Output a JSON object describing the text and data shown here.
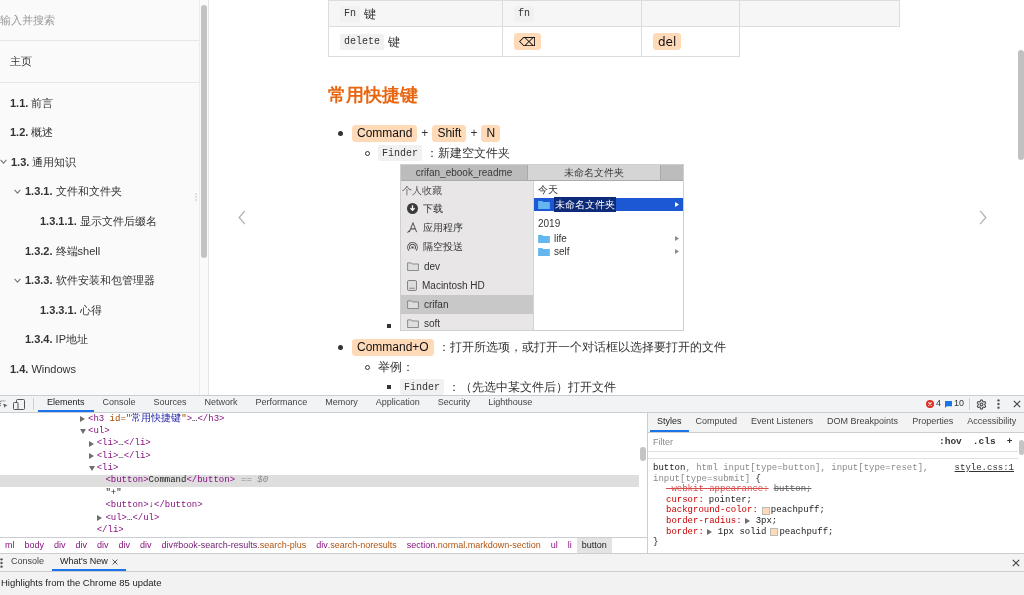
{
  "sidebar": {
    "search": {
      "placeholder": "输入并搜索"
    },
    "home": "主页",
    "items": [
      {
        "number": "1.1.",
        "title": "前言"
      },
      {
        "number": "1.2.",
        "title": "概述"
      },
      {
        "number": "1.3.",
        "title": "通用知识",
        "expanded": true,
        "children": [
          {
            "number": "1.3.1.",
            "title": "文件和文件夹",
            "expanded": true,
            "children": [
              {
                "number": "1.3.1.1.",
                "title": "显示文件后缀名"
              }
            ]
          },
          {
            "number": "1.3.2.",
            "title": "终端shell"
          },
          {
            "number": "1.3.3.",
            "title": "软件安装和包管理器",
            "expanded": true,
            "children": [
              {
                "number": "1.3.3.1.",
                "title": "心得"
              }
            ]
          },
          {
            "number": "1.3.4.",
            "title": "IP地址"
          }
        ]
      },
      {
        "number": "1.4.",
        "title": "Windows"
      }
    ]
  },
  "page": {
    "table": {
      "rows": [
        {
          "cells": [
            {
              "kind": "code_label",
              "code": "Fn",
              "text": "键"
            },
            {
              "kind": "code",
              "code": "fn"
            },
            {
              "kind": "empty"
            },
            {
              "kind": "empty"
            }
          ]
        },
        {
          "cells": [
            {
              "kind": "code_label",
              "code": "delete",
              "text": "键"
            },
            {
              "kind": "key",
              "text": "⌫"
            },
            {
              "kind": "key",
              "text": "del"
            }
          ]
        }
      ]
    },
    "heading": "常用快捷键",
    "list": [
      {
        "parts": [
          {
            "kind": "key",
            "text": "Command"
          },
          {
            "kind": "text",
            "text": "+"
          },
          {
            "kind": "key",
            "text": "Shift"
          },
          {
            "kind": "text",
            "text": "+"
          },
          {
            "kind": "key",
            "text": "N"
          }
        ],
        "children": [
          {
            "parts": [
              {
                "kind": "code",
                "text": "Finder"
              },
              {
                "kind": "text",
                "text": "：新建空文件夹"
              }
            ],
            "children": [
              {
                "parts": [
                  {
                    "kind": "finder_window",
                    "tabs": [
                      {
                        "label": "crifan_ebook_readme",
                        "selected": false
                      },
                      {
                        "label": "未命名文件夹",
                        "selected": true
                      }
                    ],
                    "sidebar": {
                      "heading": "个人收藏",
                      "items": [
                        {
                          "kind": "download",
                          "label": "下载",
                          "selected": false
                        },
                        {
                          "kind": "applications",
                          "label": "应用程序",
                          "selected": false
                        },
                        {
                          "kind": "airdrop",
                          "label": "隔空投送",
                          "selected": false
                        },
                        {
                          "kind": "folder",
                          "label": "dev",
                          "selected": false
                        },
                        {
                          "kind": "disk",
                          "label": "Macintosh HD",
                          "selected": false
                        },
                        {
                          "kind": "folder",
                          "label": "crifan",
                          "selected": true
                        },
                        {
                          "kind": "folder",
                          "label": "soft",
                          "selected": false
                        }
                      ]
                    },
                    "groups": [
                      {
                        "heading": "今天",
                        "items": [
                          {
                            "label": "未命名文件夹",
                            "selected": true
                          }
                        ]
                      },
                      {
                        "heading": "2019",
                        "items": [
                          {
                            "label": "life",
                            "selected": false
                          },
                          {
                            "label": "self",
                            "selected": false
                          }
                        ]
                      }
                    ]
                  }
                ]
              }
            ]
          }
        ]
      },
      {
        "parts": [
          {
            "kind": "key",
            "text": "Command+O"
          },
          {
            "kind": "text",
            "text": "：打开所选项，或打开一个对话框以选择要打开的文件"
          }
        ],
        "children": [
          {
            "parts": [
              {
                "kind": "text",
                "text": "举例："
              }
            ],
            "children": [
              {
                "parts": [
                  {
                    "kind": "code",
                    "text": "Finder"
                  },
                  {
                    "kind": "text",
                    "text": "：（先选中某文件后）打开文件"
                  }
                ]
              }
            ]
          }
        ]
      }
    ]
  },
  "devtools": {
    "toolbar": {
      "tabs": [
        {
          "label": "Elements",
          "selected": true
        },
        {
          "label": "Console",
          "selected": false
        },
        {
          "label": "Sources",
          "selected": false
        },
        {
          "label": "Network",
          "selected": false
        },
        {
          "label": "Performance",
          "selected": false
        },
        {
          "label": "Memory",
          "selected": false
        },
        {
          "label": "Application",
          "selected": false
        },
        {
          "label": "Security",
          "selected": false
        },
        {
          "label": "Lighthouse",
          "selected": false
        }
      ],
      "error_count": "4",
      "message_count": "10"
    },
    "dom_tree": [
      {
        "expanded": false,
        "selected": false,
        "tokens": [
          {
            "kind": "tag",
            "text": "<h3"
          },
          {
            "kind": "attr",
            "text": " id=\""
          },
          {
            "kind": "value",
            "text": "常用快捷键"
          },
          {
            "kind": "attr",
            "text": "\""
          },
          {
            "kind": "tag",
            "text": ">"
          },
          {
            "kind": "text",
            "text": "…"
          },
          {
            "kind": "tag",
            "text": "</h3>"
          }
        ]
      },
      {
        "expanded": true,
        "selected": false,
        "tokens": [
          {
            "kind": "tag",
            "text": "<ul>"
          }
        ],
        "children": [
          {
            "expanded": false,
            "selected": false,
            "tokens": [
              {
                "kind": "tag",
                "text": "<li>"
              },
              {
                "kind": "text",
                "text": "…"
              },
              {
                "kind": "tag",
                "text": "</li>"
              }
            ]
          },
          {
            "expanded": false,
            "selected": false,
            "tokens": [
              {
                "kind": "tag",
                "text": "<li>"
              },
              {
                "kind": "text",
                "text": "…"
              },
              {
                "kind": "tag",
                "text": "</li>"
              }
            ]
          },
          {
            "expanded": true,
            "selected": false,
            "tokens": [
              {
                "kind": "tag",
                "text": "<li>"
              }
            ],
            "closing": [
              {
                "kind": "tag",
                "text": "</li>"
              }
            ],
            "children": [
              {
                "selected": true,
                "tokens": [
                  {
                    "kind": "tag",
                    "text": "<button>"
                  },
                  {
                    "kind": "text",
                    "text": "Command"
                  },
                  {
                    "kind": "tag",
                    "text": "</button>"
                  }
                ],
                "hint": "== $0"
              },
              {
                "selected": false,
                "tokens": [
                  {
                    "kind": "text",
                    "text": "\"+\""
                  }
                ]
              },
              {
                "selected": false,
                "tokens": [
                  {
                    "kind": "tag",
                    "text": "<button>"
                  },
                  {
                    "kind": "text",
                    "text": "↓"
                  },
                  {
                    "kind": "tag",
                    "text": "</button>"
                  }
                ]
              },
              {
                "expanded": false,
                "selected": false,
                "tokens": [
                  {
                    "kind": "tag",
                    "text": "<ul>"
                  },
                  {
                    "kind": "text",
                    "text": "…"
                  },
                  {
                    "kind": "tag",
                    "text": "</ul>"
                  }
                ]
              }
            ]
          }
        ]
      }
    ],
    "breadcrumbs": [
      {
        "tag": "ml",
        "selected": false
      },
      {
        "tag": "body",
        "selected": false
      },
      {
        "tag": "div",
        "selected": false
      },
      {
        "tag": "div",
        "selected": false
      },
      {
        "tag": "div",
        "selected": false
      },
      {
        "tag": "div",
        "selected": false
      },
      {
        "tag": "div",
        "selected": false
      },
      {
        "tag": "div",
        "id": "#book-search-results",
        "classes": ".search-plus",
        "selected": false
      },
      {
        "tag": "div",
        "classes": ".search-noresults",
        "selected": false
      },
      {
        "tag": "section",
        "classes": ".normal.markdown-section",
        "selected": false
      },
      {
        "tag": "ul",
        "selected": false
      },
      {
        "tag": "li",
        "selected": false
      },
      {
        "tag": "button",
        "selected": true
      }
    ],
    "styles": {
      "tabs": [
        {
          "label": "Styles",
          "selected": true
        },
        {
          "label": "Computed",
          "selected": false
        },
        {
          "label": "Event Listeners",
          "selected": false
        },
        {
          "label": "DOM Breakpoints",
          "selected": false
        },
        {
          "label": "Properties",
          "selected": false
        },
        {
          "label": "Accessibility",
          "selected": false
        }
      ],
      "filter": {
        "placeholder": "Filter"
      },
      "actions": [
        ":hov",
        ".cls",
        "+"
      ],
      "rule": {
        "selector_lines": [
          [
            {
              "kind": "matched",
              "text": "button"
            },
            {
              "kind": "unmatched",
              "text": ", html input[type=button], input[type=reset],"
            }
          ],
          [
            {
              "kind": "unmatched",
              "text": "input[type=submit]"
            },
            {
              "kind": "punct",
              "text": " {"
            }
          ]
        ],
        "source": "style.css:1",
        "declarations": [
          {
            "name": "-webkit-appearance:",
            "value": [
              {
                "text": "button;"
              }
            ],
            "overridden": true,
            "expandable": false
          },
          {
            "name": "cursor:",
            "value": [
              {
                "text": "pointer;"
              }
            ],
            "overridden": false,
            "expandable": false
          },
          {
            "name": "background-color:",
            "value": [
              {
                "text": "peachpuff;",
                "color": "#ffdab9"
              }
            ],
            "overridden": false,
            "expandable": false
          },
          {
            "name": "border-radius:",
            "value": [
              {
                "text": "3px;"
              }
            ],
            "overridden": false,
            "expandable": true
          },
          {
            "name": "border:",
            "value": [
              {
                "text": "1px solid"
              },
              {
                "text": "peachpuff;",
                "color": "#ffdab9"
              }
            ],
            "overridden": false,
            "expandable": true
          }
        ],
        "closing": "}"
      }
    },
    "drawer": {
      "tabs": [
        {
          "label": "Console",
          "selected": false,
          "closable": false
        },
        {
          "label": "What's New",
          "selected": true,
          "closable": true
        }
      ],
      "content": "Highlights from the Chrome 85 update"
    }
  }
}
